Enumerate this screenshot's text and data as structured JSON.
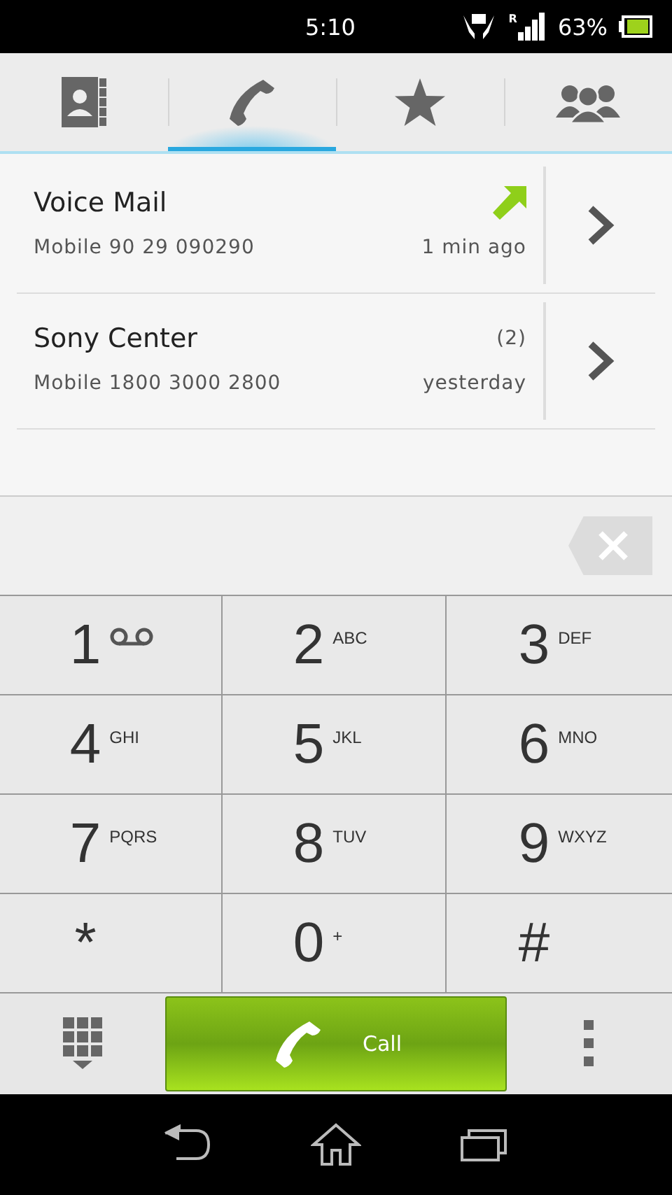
{
  "status_bar": {
    "time": "5:10",
    "roaming": "R",
    "battery": "63%"
  },
  "tabs": [
    {
      "kind": "contacts",
      "selected": false
    },
    {
      "kind": "phone",
      "selected": true
    },
    {
      "kind": "favorites",
      "selected": false
    },
    {
      "kind": "groups",
      "selected": false
    }
  ],
  "call_log": [
    {
      "name": "Voice Mail",
      "number": "Mobile 90 29 090290",
      "time": "1 min ago",
      "outgoing": true
    },
    {
      "name": "Sony Center",
      "number": "Mobile 1800 3000 2800",
      "time": "yesterday",
      "count": "(2)",
      "outgoing": false
    }
  ],
  "keypad": [
    {
      "digit": "1",
      "kind": "voicemail"
    },
    {
      "digit": "2",
      "letters": "ABC"
    },
    {
      "digit": "3",
      "letters": "DEF"
    },
    {
      "digit": "4",
      "letters": "GHI"
    },
    {
      "digit": "5",
      "letters": "JKL"
    },
    {
      "digit": "6",
      "letters": "MNO"
    },
    {
      "digit": "7",
      "letters": "PQRS"
    },
    {
      "digit": "8",
      "letters": "TUV"
    },
    {
      "digit": "9",
      "letters": "WXYZ"
    },
    {
      "digit": "*"
    },
    {
      "digit": "0",
      "letters": "+"
    },
    {
      "digit": "#"
    }
  ],
  "call_button": {
    "label": "Call"
  }
}
